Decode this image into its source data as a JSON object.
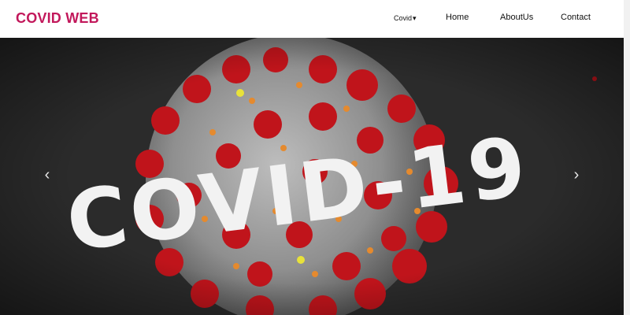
{
  "brand": {
    "name": "COVID WEB",
    "color": "#c2185b"
  },
  "nav": {
    "items": [
      {
        "label": "Covid",
        "has_dropdown": true,
        "caret": "▾"
      },
      {
        "label": "Home"
      },
      {
        "label": "AboutUs"
      },
      {
        "label": "Contact"
      }
    ]
  },
  "carousel": {
    "slide_text": "COVID-19",
    "prev_icon": "‹",
    "next_icon": "›",
    "colors": {
      "background": "#2a2a2a",
      "spike": "#c0141b",
      "virus_body": "#9a9a9a",
      "text": "#f2f2f2"
    }
  }
}
